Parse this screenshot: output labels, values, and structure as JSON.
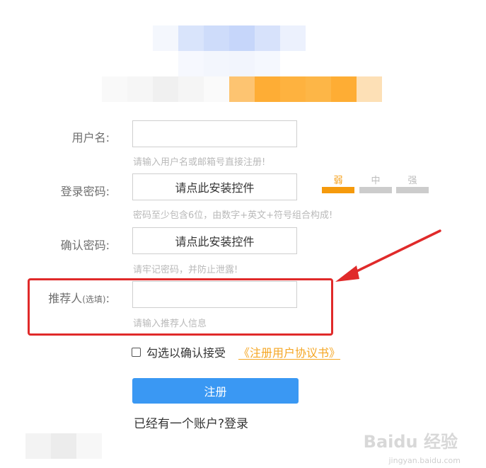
{
  "colors": {
    "accent_blue": "#3a98f3",
    "link_orange": "#f5a623",
    "weak_orange": "#f59a0c",
    "bar_grey": "#cccccc",
    "annotation_red": "#e02a2a"
  },
  "form": {
    "username": {
      "label": "用户名:",
      "value": "",
      "hint": "请输入用户名或邮箱号直接注册!"
    },
    "password": {
      "label": "登录密码:",
      "control_text": "请点此安装控件",
      "hint": "密码至少包含6位，由数字+英文+符号组合构成!",
      "strength": {
        "weak": "弱",
        "medium": "中",
        "strong": "强",
        "level": "weak"
      }
    },
    "confirm": {
      "label": "确认密码:",
      "control_text": "请点此安装控件",
      "hint": "请牢记密码，并防止泄露!"
    },
    "referrer": {
      "label": "推荐人",
      "label_small": "(选填)",
      "label_colon": ":",
      "value": "",
      "hint": "请输入推荐人信息"
    },
    "agreement": {
      "checked": false,
      "text": "勾选以确认接受",
      "link": "《注册用户协议书》"
    },
    "submit_label": "注册",
    "login_text": "已经有一个账户?登录"
  },
  "watermark": {
    "main": "Baidu 经验",
    "sub": "jingyan.baidu.com"
  }
}
